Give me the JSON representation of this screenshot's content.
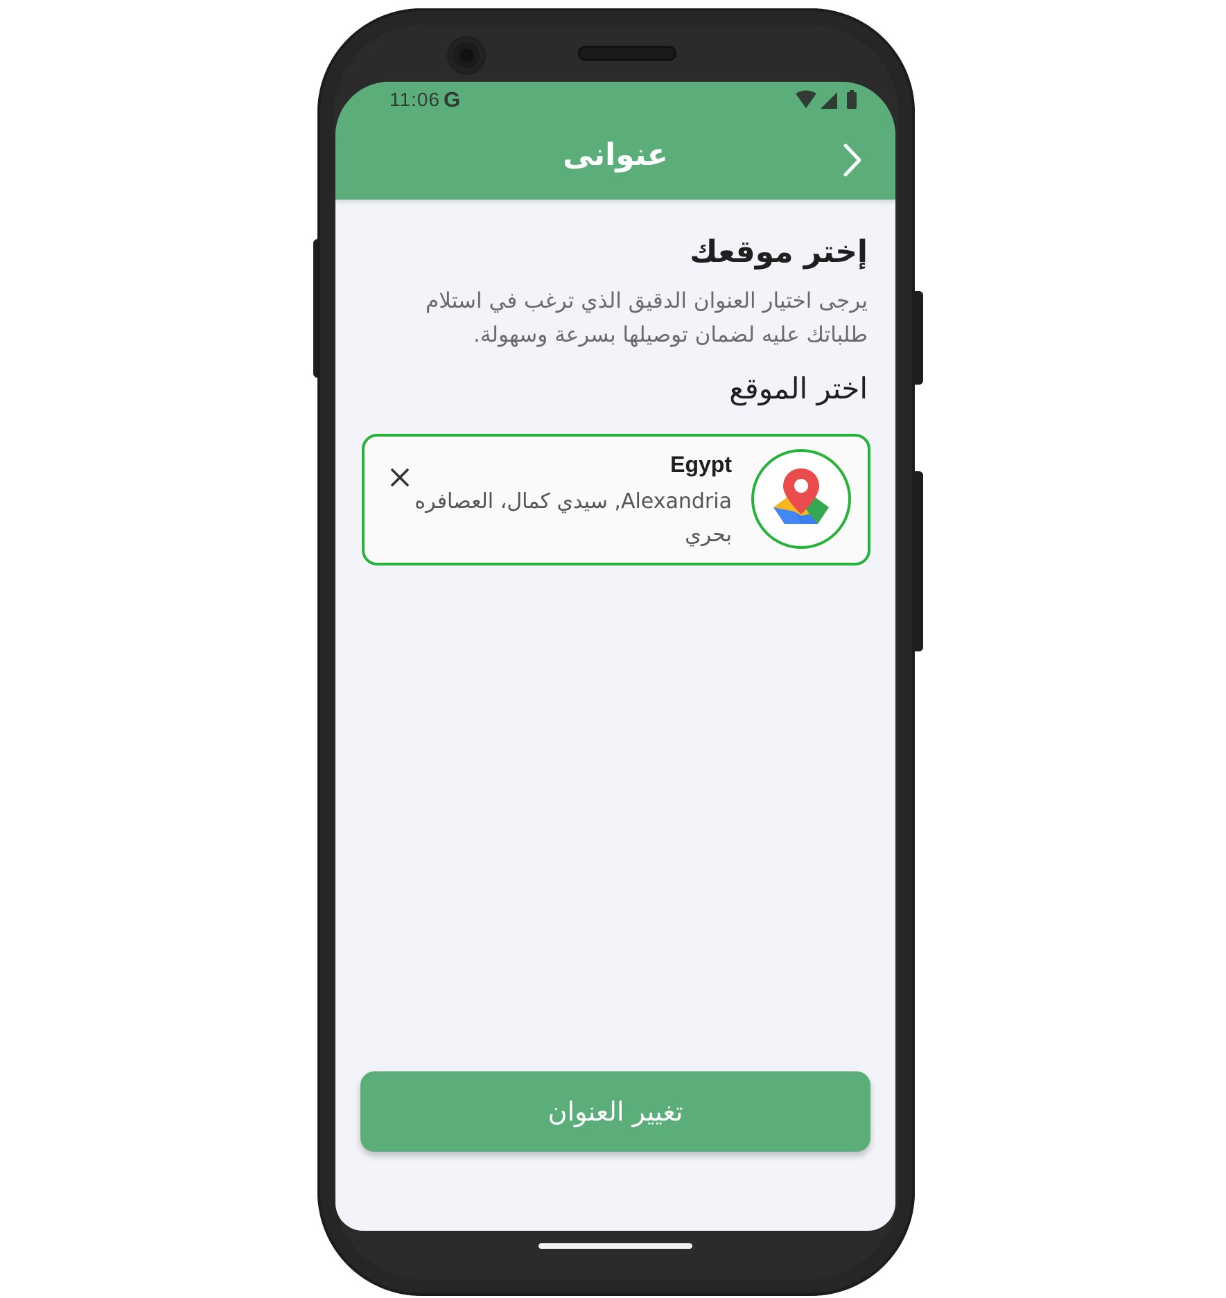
{
  "status_bar": {
    "time": "11:06",
    "carrier_icon": "G",
    "icons": [
      "wifi-icon",
      "signal-icon",
      "battery-icon"
    ]
  },
  "app_bar": {
    "title": "عنوانى",
    "back_icon": "chevron-right-icon"
  },
  "main": {
    "heading": "إختر موقعك",
    "description": "يرجى اختيار العنوان الدقيق الذي ترغب في استلام طلباتك عليه لضمان توصيلها بسرعة وسهولة.",
    "subheading": "اختر الموقع"
  },
  "location_card": {
    "icon": "map-pin-icon",
    "country": "Egypt",
    "address": "Alexandria, سيدي كمال، العصافره بحري",
    "close_icon": "close-icon"
  },
  "action": {
    "change_address_label": "تغيير العنوان"
  },
  "colors": {
    "primary": "#5bae79",
    "card_border": "#27b23a",
    "background": "#f3f4f9"
  }
}
